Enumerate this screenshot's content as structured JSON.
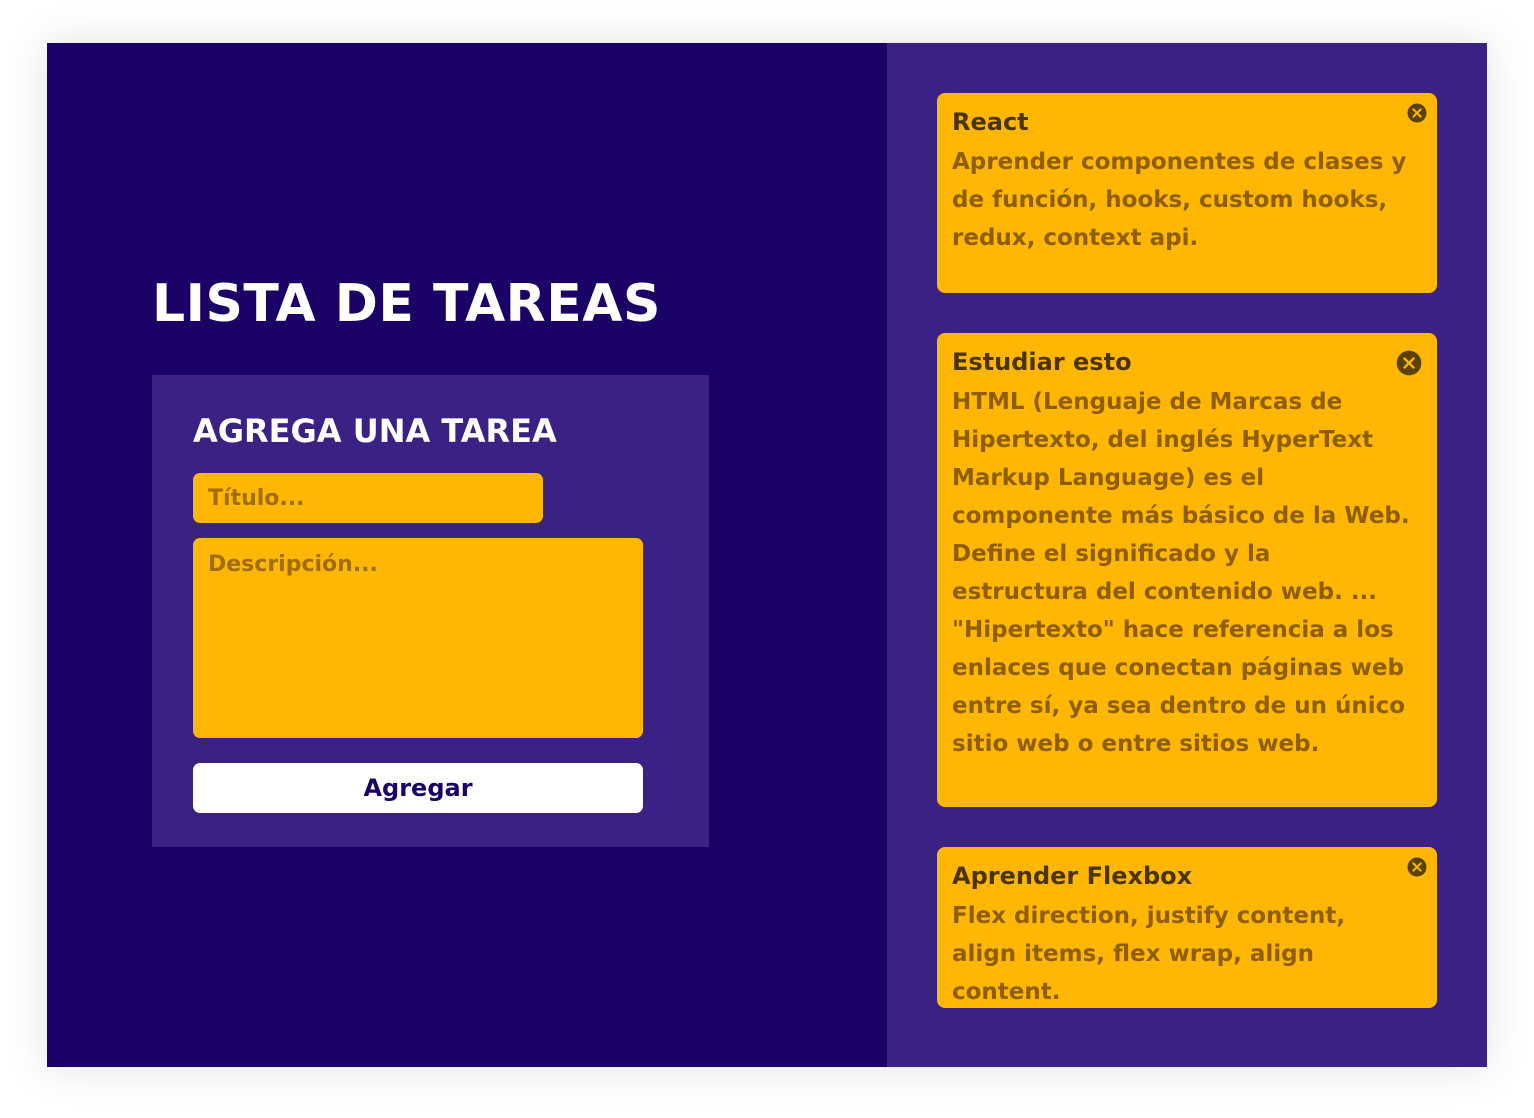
{
  "header": {
    "title": "LISTA DE TAREAS"
  },
  "form": {
    "title": "AGREGA UNA TAREA",
    "title_placeholder": "Título...",
    "title_value": "",
    "description_placeholder": "Descripción...",
    "description_value": "",
    "submit_label": "Agregar"
  },
  "tasks": [
    {
      "title": "React",
      "description": "Aprender componentes de clases y de función, hooks, custom hooks, redux, context api.",
      "close_icon": "close-circle-icon"
    },
    {
      "title": "Estudiar esto",
      "description": "HTML (Lenguaje de Marcas de Hipertexto, del inglés HyperText Markup Language) es el componente más básico de la Web. Define el significado y la estructura del contenido web. ... \"Hipertexto\" hace referencia a los enlaces que conectan páginas web entre sí, ya sea dentro de un único sitio web o entre sitios web.",
      "close_icon": "close-circle-icon"
    },
    {
      "title": "Aprender Flexbox",
      "description": "Flex direction, justify content, align items, flex wrap, align content.",
      "close_icon": "close-circle-icon"
    }
  ],
  "colors": {
    "left_panel_bg": "#1b0066",
    "right_panel_bg": "#3b2183",
    "accent_yellow": "#ffb703",
    "button_bg": "#ffffff",
    "button_text": "#1b0066"
  }
}
